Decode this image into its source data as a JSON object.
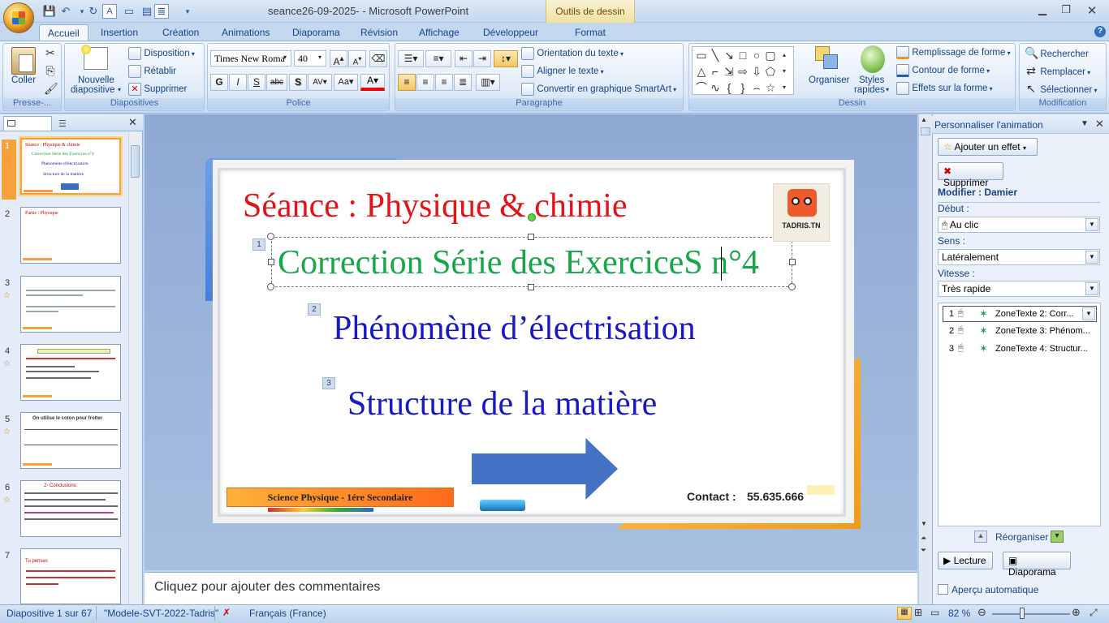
{
  "window": {
    "title": "seance26-09-2025-  -  Microsoft PowerPoint",
    "context_tab": "Outils de dessin"
  },
  "tabs": [
    "Accueil",
    "Insertion",
    "Création",
    "Animations",
    "Diaporama",
    "Révision",
    "Affichage",
    "Développeur",
    "Format"
  ],
  "ribbon": {
    "clipboard": {
      "paste": "Coller",
      "group": "Presse-..."
    },
    "slides": {
      "new_slide_1": "Nouvelle",
      "new_slide_2": "diapositive",
      "layout": "Disposition",
      "reset": "Rétablir",
      "delete": "Supprimer",
      "group": "Diapositives"
    },
    "font": {
      "font_name": "Times New Roma",
      "font_size": "40",
      "group": "Police"
    },
    "paragraph": {
      "text_direction": "Orientation du texte",
      "align_text": "Aligner le texte",
      "smartart": "Convertir en graphique SmartArt",
      "group": "Paragraphe"
    },
    "drawing": {
      "arrange": "Organiser",
      "styles_1": "Styles",
      "styles_2": "rapides",
      "fill": "Remplissage de forme",
      "outline": "Contour de forme",
      "effects": "Effets sur la forme",
      "group": "Dessin"
    },
    "editing": {
      "find": "Rechercher",
      "replace": "Remplacer",
      "select": "Sélectionner",
      "group": "Modification"
    }
  },
  "slides_pane": {
    "numbers": [
      "1",
      "2",
      "3",
      "4",
      "5",
      "6",
      "7"
    ],
    "thumb1": {
      "line1": "Séance : Physique & chimie",
      "line2": "Correction Série des Exercices n°4",
      "line3": "Phénomène d'électrisation",
      "line4": "Structure de la matière"
    },
    "thumb2": {
      "line1": "Partie : Physique"
    },
    "thumb5": {
      "line1": "On utilise le coton pour frotter"
    },
    "thumb6": {
      "line1": "2- Conclusions:"
    },
    "thumb7": {
      "line1": "Tu penses"
    }
  },
  "slide": {
    "title": "Séance : Physique & chimie",
    "subtitle": "Correction Série des ExerciceS n°4",
    "item2": "Phénomène d’électrisation",
    "item3": "Structure de la matière",
    "badge1": "1",
    "badge2": "2",
    "badge3": "3",
    "footer_label": "Science Physique  - 1ére Secondaire",
    "contact_label": "Contact :",
    "contact_value": "55.635.666",
    "logo_text": "TADRIS.TN"
  },
  "notes": {
    "placeholder": "Cliquez pour ajouter des commentaires"
  },
  "task_pane": {
    "title": "Personnaliser l'animation",
    "add_effect": "Ajouter un effet",
    "remove": "Supprimer",
    "modify": "Modifier : Damier",
    "start_label": "Début :",
    "start_value": "Au clic",
    "direction_label": "Sens :",
    "direction_value": "Latéralement",
    "speed_label": "Vitesse :",
    "speed_value": "Très rapide",
    "items": [
      {
        "num": "1",
        "label": "ZoneTexte 2: Corr..."
      },
      {
        "num": "2",
        "label": "ZoneTexte 3: Phénom..."
      },
      {
        "num": "3",
        "label": "ZoneTexte 4: Structur..."
      }
    ],
    "reorder": "Réorganiser",
    "play": "Lecture",
    "slideshow": "Diaporama",
    "autopreview": "Aperçu automatique"
  },
  "status": {
    "slide_info": "Diapositive 1 sur 67",
    "theme": "\"Modele-SVT-2022-Tadris\"",
    "language": "Français (France)",
    "zoom": "82 %"
  }
}
